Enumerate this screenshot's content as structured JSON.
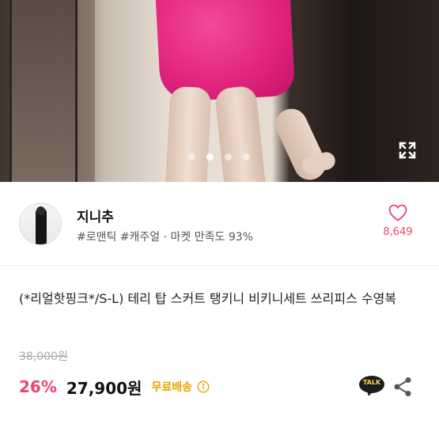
{
  "gallery": {
    "dots": [
      false,
      true,
      false,
      false
    ],
    "expand_icon": "expand-icon"
  },
  "seller": {
    "name": "지니추",
    "tags": "#로맨틱 #캐주얼 · 마켓 만족도 93%",
    "like_count": "8,649",
    "colors": {
      "accent": "#e8476d"
    }
  },
  "product": {
    "title": "(*리얼핫핑크*/S-L) 테리 탑 스커트 탱키니 비키니세트 쓰리피스 수영복",
    "original_price": "38,000원",
    "discount": "26%",
    "price": "27,900원",
    "shipping": "무료배송",
    "talk_label": "TALK"
  },
  "colors": {
    "discount": "#e8476d",
    "shipping": "#e8a400",
    "talk_bg": "#1c1c1c",
    "talk_text": "#f7d94c"
  }
}
